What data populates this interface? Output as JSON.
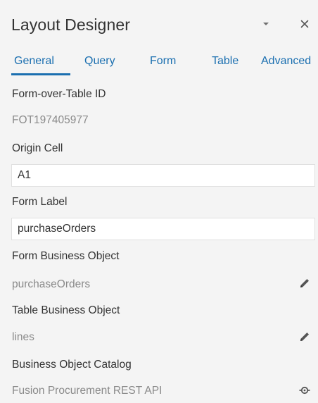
{
  "header": {
    "title": "Layout Designer"
  },
  "tabs": [
    {
      "label": "General",
      "active": true
    },
    {
      "label": "Query"
    },
    {
      "label": "Form"
    },
    {
      "label": "Table"
    },
    {
      "label": "Advanced"
    }
  ],
  "fields": {
    "form_over_table_id": {
      "label": "Form-over-Table ID",
      "value": "FOT197405977"
    },
    "origin_cell": {
      "label": "Origin Cell",
      "value": "A1"
    },
    "form_label": {
      "label": "Form Label",
      "value": "purchaseOrders"
    },
    "form_business_object": {
      "label": "Form Business Object",
      "value": "purchaseOrders"
    },
    "table_business_object": {
      "label": "Table Business Object",
      "value": "lines"
    },
    "business_object_catalog": {
      "label": "Business Object Catalog",
      "value": "Fusion Procurement REST API"
    }
  },
  "icons": {
    "menu": "caret-down-icon",
    "close": "close-icon",
    "edit": "pencil-icon",
    "catalog": "service-icon"
  },
  "colors": {
    "accent": "#1b6fb0",
    "background": "#f4f4f4",
    "muted_text": "#8a8a8a"
  }
}
